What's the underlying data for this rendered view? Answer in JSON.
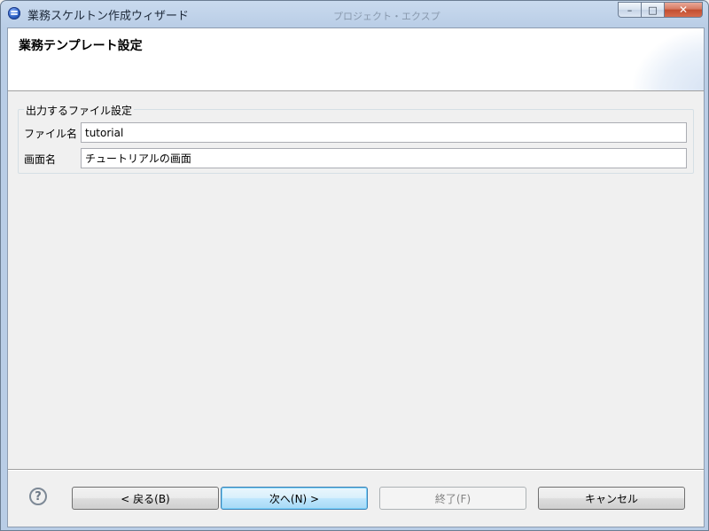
{
  "window": {
    "title": "業務スケルトン作成ウィザード",
    "background_hint": "プロジェクト・エクスプ"
  },
  "header": {
    "title": "業務テンプレート設定"
  },
  "group": {
    "legend": "出力するファイル設定",
    "fields": [
      {
        "label": "ファイル名",
        "value": "tutorial"
      },
      {
        "label": "画面名",
        "value": "チュートリアルの画面"
      }
    ]
  },
  "buttons": {
    "help": "?",
    "back": "< 戻る(B)",
    "next": "次へ(N) >",
    "finish": "終了(F)",
    "cancel": "キャンセル"
  },
  "window_controls": {
    "minimize": "–",
    "maximize": "□",
    "close": "✕"
  },
  "colors": {
    "default_button_border": "#3c7fb1",
    "title_bar": "#b9cde6",
    "close_button": "#c24e30"
  },
  "icons": {
    "app": "eclipse-icon",
    "help": "help-icon"
  }
}
